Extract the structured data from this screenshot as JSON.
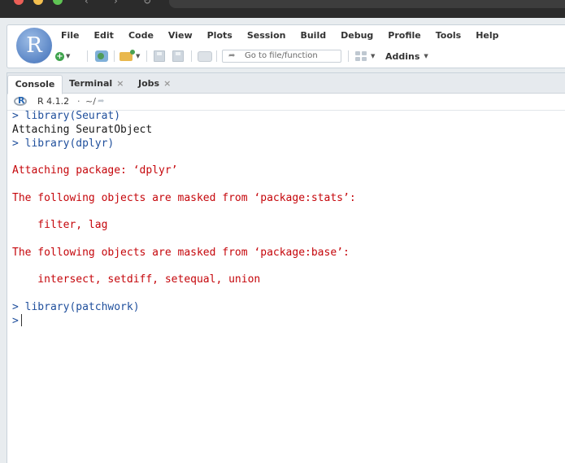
{
  "menubar": {
    "items": [
      "File",
      "Edit",
      "Code",
      "View",
      "Plots",
      "Session",
      "Build",
      "Debug",
      "Profile",
      "Tools",
      "Help"
    ]
  },
  "toolbar": {
    "goto_placeholder": "Go to file/function",
    "addins_label": "Addins"
  },
  "logo": {
    "letter": "R"
  },
  "console_pane": {
    "tabs": [
      {
        "label": "Console",
        "closable": false,
        "active": true
      },
      {
        "label": "Terminal",
        "closable": true,
        "active": false
      },
      {
        "label": "Jobs",
        "closable": true,
        "active": false
      }
    ],
    "close_glyph": "×",
    "r_version": "R 4.1.2",
    "separator": "·",
    "working_dir": "~/",
    "lines": [
      {
        "kind": "cmd",
        "text": "> library(Seurat)"
      },
      {
        "kind": "out",
        "text": "Attaching SeuratObject"
      },
      {
        "kind": "cmd",
        "text": "> library(dplyr)"
      },
      {
        "kind": "msg",
        "text": ""
      },
      {
        "kind": "msg",
        "text": "Attaching package: ‘dplyr’"
      },
      {
        "kind": "msg",
        "text": ""
      },
      {
        "kind": "msg",
        "text": "The following objects are masked from ‘package:stats’:"
      },
      {
        "kind": "msg",
        "text": ""
      },
      {
        "kind": "msg",
        "text": "    filter, lag"
      },
      {
        "kind": "msg",
        "text": ""
      },
      {
        "kind": "msg",
        "text": "The following objects are masked from ‘package:base’:"
      },
      {
        "kind": "msg",
        "text": ""
      },
      {
        "kind": "msg",
        "text": "    intersect, setdiff, setequal, union"
      },
      {
        "kind": "msg",
        "text": ""
      },
      {
        "kind": "cmd",
        "text": "> library(patchwork)"
      }
    ],
    "prompt": ">"
  },
  "colors": {
    "command": "#1f4f9c",
    "message": "#c5060b",
    "output": "#1a1a1a",
    "accent": "#5b86c6"
  }
}
